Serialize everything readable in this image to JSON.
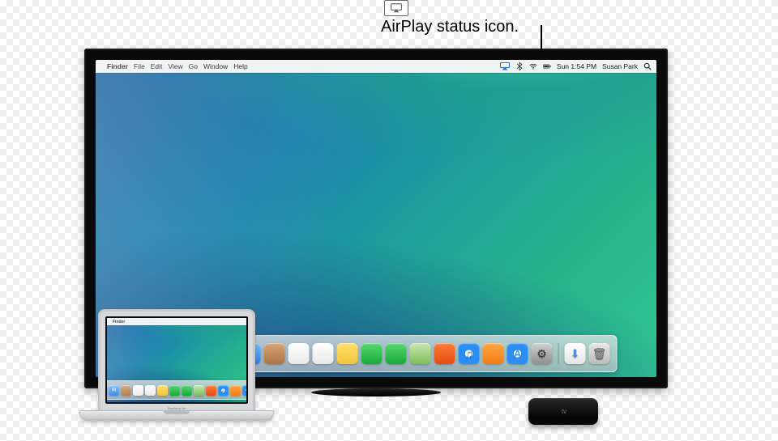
{
  "callout": {
    "label": "AirPlay status icon."
  },
  "menubar": {
    "apple_glyph": "",
    "app_name": "Finder",
    "items": [
      "File",
      "Edit",
      "View",
      "Go",
      "Window",
      "Help"
    ],
    "right": {
      "airplay": "airplay",
      "bluetooth": "bluetooth",
      "wifi": "wifi",
      "battery": "battery",
      "clock": "Sun 1:54 PM",
      "user": "Susan Park",
      "spotlight": "spotlight"
    }
  },
  "dock": {
    "apps": [
      {
        "name": "finder",
        "glyph": "",
        "bg": "linear-gradient(#4db4ff,#1676e8)"
      },
      {
        "name": "launchpad",
        "glyph": "",
        "bg": "radial-gradient(circle,#ff6a6a,#ffb24e,#58d060,#4aa6ff)"
      },
      {
        "name": "mission-control",
        "glyph": "",
        "bg": "linear-gradient(#3a3a3a,#111)"
      },
      {
        "name": "safari",
        "glyph": "",
        "bg": "radial-gradient(circle,#fefefe 28%,#2a8ef4 30%)"
      },
      {
        "name": "mail",
        "glyph": "✉︎",
        "bg": "linear-gradient(#6fbaf7,#1f78e6)"
      },
      {
        "name": "contacts",
        "glyph": "",
        "bg": "linear-gradient(#d7a377,#a9713f)"
      },
      {
        "name": "calendar",
        "glyph": "",
        "bg": "linear-gradient(#fff,#eaeaea)",
        "fg": "#e33"
      },
      {
        "name": "reminders",
        "glyph": "",
        "bg": "linear-gradient(#fff,#e8e8e8)",
        "fg": "#444"
      },
      {
        "name": "notes",
        "glyph": "",
        "bg": "linear-gradient(#ffe16b,#f2c43b)",
        "fg": "#7a5a00"
      },
      {
        "name": "messages",
        "glyph": "",
        "bg": "linear-gradient(#58d973,#16a936)"
      },
      {
        "name": "facetime",
        "glyph": "",
        "bg": "linear-gradient(#58d973,#16a936)"
      },
      {
        "name": "maps",
        "glyph": "",
        "bg": "linear-gradient(#c9e6b0,#7fbf5a)"
      },
      {
        "name": "photo-booth",
        "glyph": "",
        "bg": "linear-gradient(#ff7d3b,#e44b10)"
      },
      {
        "name": "itunes",
        "glyph": "♫",
        "bg": "radial-gradient(circle,#fff 24%,#2a8ef4 26%)",
        "fg": "#2a8ef4"
      },
      {
        "name": "ibooks",
        "glyph": "",
        "bg": "linear-gradient(#ffa547,#f47d14)"
      },
      {
        "name": "app-store",
        "glyph": "A",
        "bg": "radial-gradient(circle,#fff 24%,#2a8ef4 26%)",
        "fg": "#2a8ef4"
      },
      {
        "name": "system-preferences",
        "glyph": "⚙︎",
        "bg": "linear-gradient(#cfcfcf,#8f8f8f)",
        "fg": "#333"
      }
    ],
    "right": [
      {
        "name": "downloads",
        "glyph": "⬇︎",
        "bg": "linear-gradient(#fff,#e5e5e5)",
        "fg": "#5a8bd6"
      },
      {
        "name": "trash",
        "glyph": "🗑",
        "bg": "linear-gradient(#e7e7e7,#bcbcbc)",
        "fg": "#666"
      }
    ]
  },
  "macbook": {
    "label": "MacBook Air"
  },
  "appletv": {
    "label": "tv"
  },
  "colors": {
    "airplay_active": "#0a7aff"
  }
}
